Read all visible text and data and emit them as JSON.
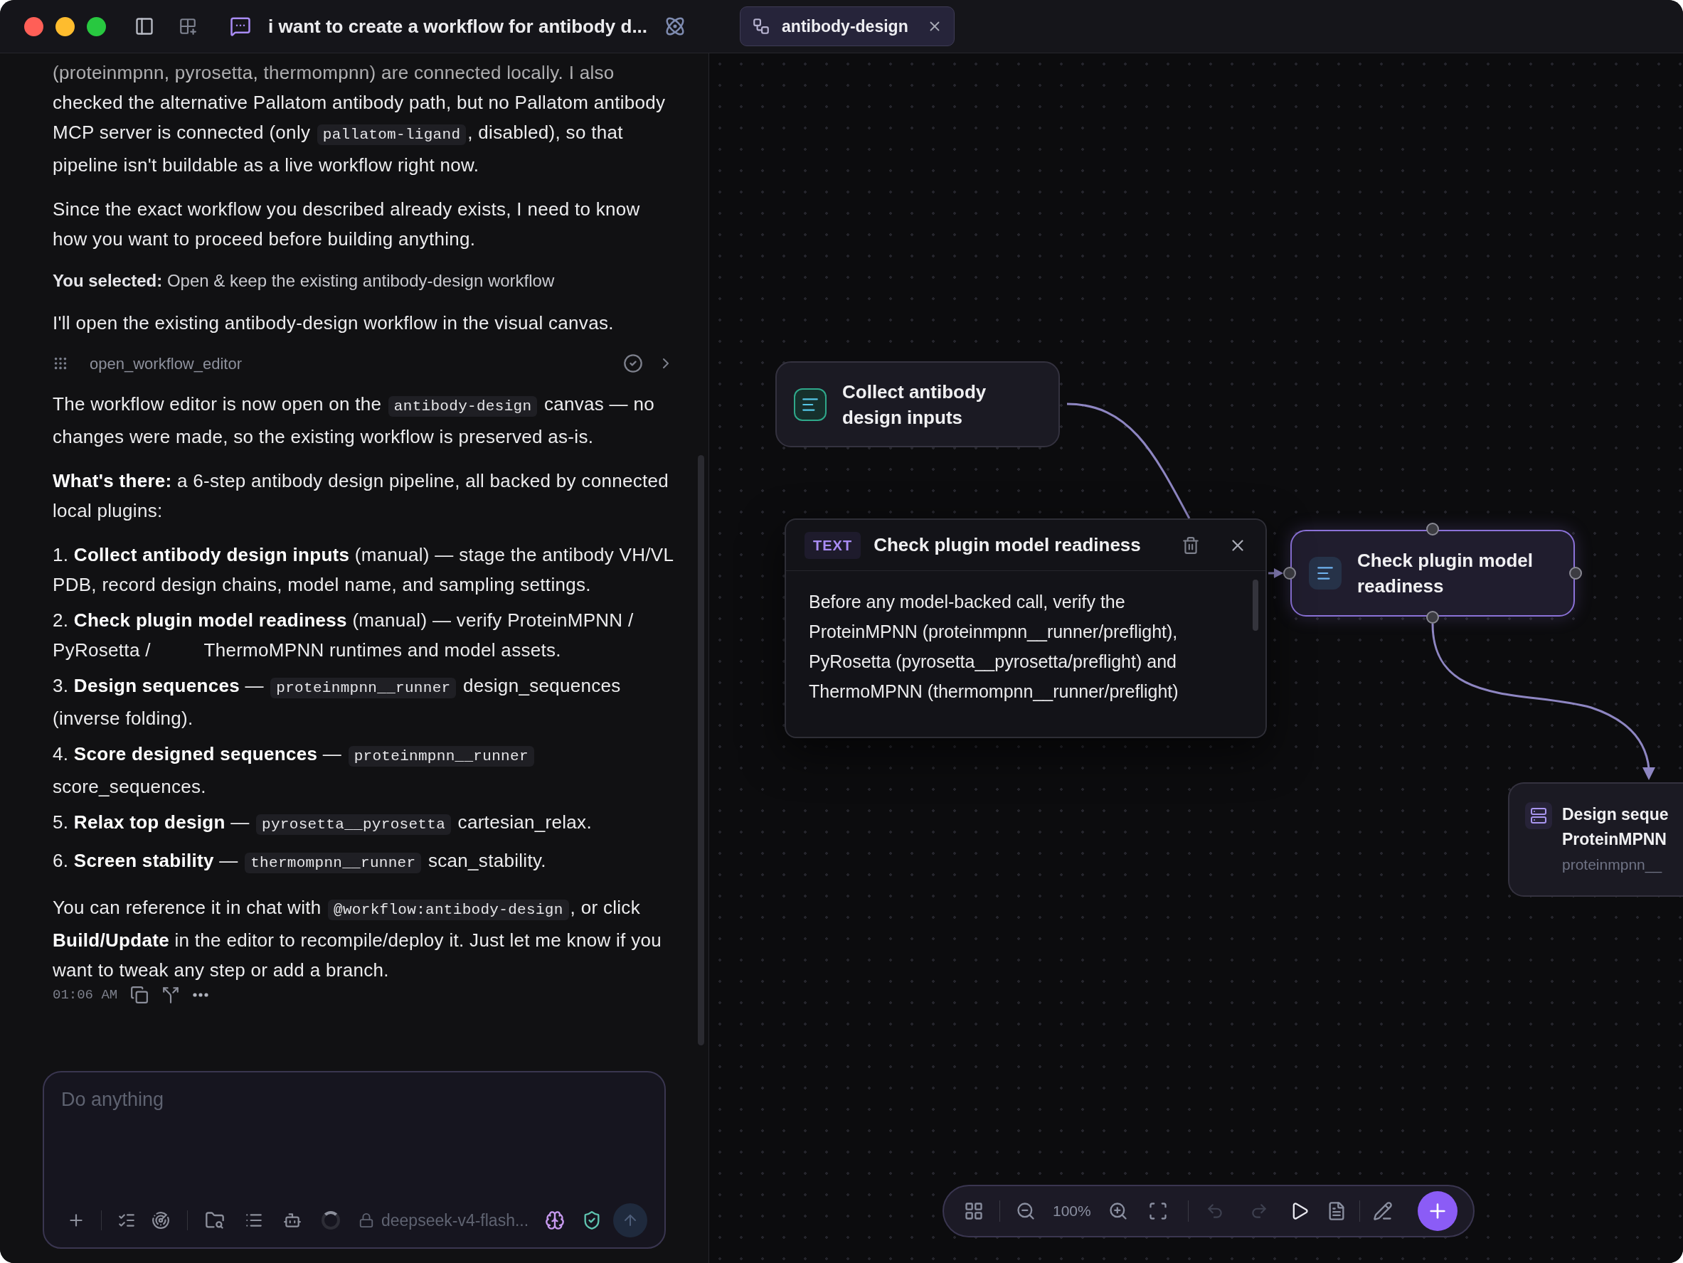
{
  "title_bar": {
    "chat_title": "i want to create a workflow for antibody d...",
    "tabs": [
      {
        "label": "antibody-design",
        "selected": true
      }
    ]
  },
  "chat": {
    "blocks": [
      {
        "kind": "paragraph",
        "segments": [
          {
            "kind": "text",
            "text": "(proteinmpnn, pyrosetta, thermompnn) are connected locally. I also checked the alternative Pallatom antibody path, but no Pallatom antibody MCP server is connected (only "
          },
          {
            "kind": "code",
            "text": "pallatom-ligand"
          },
          {
            "kind": "text",
            "text": ", disabled), so that pipeline isn't buildable as a live workflow right now."
          }
        ]
      },
      {
        "kind": "paragraph",
        "segments": [
          {
            "kind": "text",
            "text": "Since the exact workflow you described already exists, I need to know how you want to proceed before building anything."
          }
        ]
      },
      {
        "kind": "selection",
        "label": "You selected:",
        "value": "Open & keep the existing antibody-design workflow"
      },
      {
        "kind": "paragraph",
        "segments": [
          {
            "kind": "text",
            "text": "I'll open the existing antibody-design workflow in the visual canvas."
          }
        ]
      },
      {
        "kind": "tool_call",
        "name": "open_workflow_editor",
        "done": true
      },
      {
        "kind": "paragraph",
        "segments": [
          {
            "kind": "text",
            "text": "The workflow editor is now open on the "
          },
          {
            "kind": "code",
            "text": "antibody-design"
          },
          {
            "kind": "text",
            "text": " canvas — no changes were made, so the existing workflow is preserved as-is."
          }
        ]
      },
      {
        "kind": "paragraph",
        "segments": [
          {
            "kind": "bold",
            "text": "What's there:"
          },
          {
            "kind": "text",
            "text": " a 6-step antibody design pipeline, all backed by connected local plugins:"
          }
        ]
      },
      {
        "kind": "list",
        "items": [
          {
            "number": "1.",
            "segments": [
              {
                "kind": "bold",
                "text": "Collect antibody design inputs"
              },
              {
                "kind": "text",
                "text": " (manual) — stage the antibody VH/VL PDB, record design chains, model name, and sampling settings."
              }
            ]
          },
          {
            "number": "2.",
            "segments": [
              {
                "kind": "bold",
                "text": "Check plugin model readiness"
              },
              {
                "kind": "text",
                "text": " (manual) — verify ProteinMPNN /          PyRosetta /          ThermoMPNN runtimes and model assets."
              }
            ]
          },
          {
            "number": "3.",
            "segments": [
              {
                "kind": "bold",
                "text": "Design sequences"
              },
              {
                "kind": "text",
                "text": " — "
              },
              {
                "kind": "code",
                "text": "proteinmpnn__runner"
              },
              {
                "kind": "text",
                "text": " design_sequences (inverse folding)."
              }
            ]
          },
          {
            "number": "4.",
            "segments": [
              {
                "kind": "bold",
                "text": "Score designed sequences"
              },
              {
                "kind": "text",
                "text": " — "
              },
              {
                "kind": "code",
                "text": "proteinmpnn__runner"
              },
              {
                "kind": "text",
                "text": " score_sequences."
              }
            ]
          },
          {
            "number": "5.",
            "segments": [
              {
                "kind": "bold",
                "text": "Relax top design"
              },
              {
                "kind": "text",
                "text": " — "
              },
              {
                "kind": "code",
                "text": "pyrosetta__pyrosetta"
              },
              {
                "kind": "text",
                "text": " cartesian_relax."
              }
            ]
          },
          {
            "number": "6.",
            "segments": [
              {
                "kind": "bold",
                "text": "Screen stability"
              },
              {
                "kind": "text",
                "text": " — "
              },
              {
                "kind": "code",
                "text": "thermompnn__runner"
              },
              {
                "kind": "text",
                "text": " scan_stability."
              }
            ]
          }
        ]
      },
      {
        "kind": "paragraph",
        "segments": [
          {
            "kind": "text",
            "text": "You can reference it in chat with "
          },
          {
            "kind": "code",
            "text": "@workflow:antibody-design"
          },
          {
            "kind": "text",
            "text": ", or click "
          },
          {
            "kind": "bold",
            "text": "Build/Update"
          },
          {
            "kind": "text",
            "text": " in the editor to recompile/deploy it. Just let me know if you want to tweak any step or add a branch."
          }
        ]
      },
      {
        "kind": "meta",
        "time": "01:06 AM"
      }
    ]
  },
  "composer": {
    "placeholder": "Do anything",
    "model": "deepseek-v4-flash..."
  },
  "canvas": {
    "nodes": [
      {
        "kind": "manual",
        "title": "Collect antibody design inputs",
        "selected": false
      },
      {
        "kind": "manual",
        "title": "Check plugin model readiness",
        "selected": true
      },
      {
        "kind": "tool",
        "title": "Design seque",
        "subtitle": "ProteinMPNN",
        "detail": "proteinmpnn__",
        "selected": false
      }
    ],
    "popup": {
      "badge": "TEXT",
      "title": "Check plugin model readiness",
      "body": "Before any model-backed call, verify the ProteinMPNN (proteinmpnn__runner/preflight), PyRosetta (pyrosetta__pyrosetta/preflight) and ThermoMPNN (thermompnn__runner/preflight)"
    },
    "toolbar": {
      "zoom": "100%",
      "undo_disabled": true,
      "redo_disabled": true
    }
  }
}
